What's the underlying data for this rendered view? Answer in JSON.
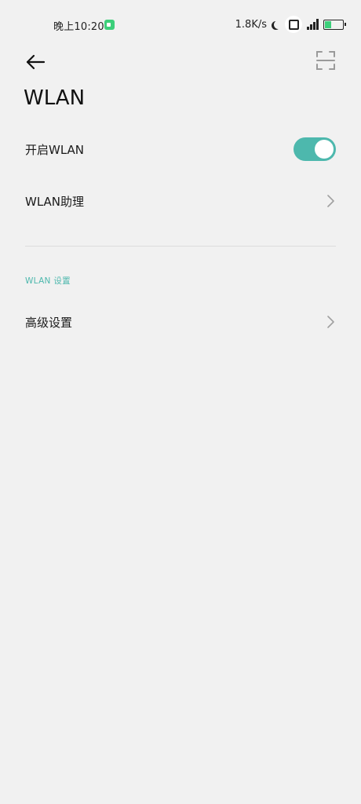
{
  "status_bar": {
    "time": "晚上10:20",
    "net_speed": "1.8K/s"
  },
  "header": {
    "title": "WLAN"
  },
  "settings": {
    "wlan_toggle_label": "开启WLAN",
    "wlan_toggle_on": true,
    "wlan_assistant_label": "WLAN助理",
    "section_label": "WLAN 设置",
    "advanced_label": "高级设置"
  },
  "colors": {
    "accent": "#4db8ad",
    "background": "#f1f1f1"
  },
  "icons": {
    "back": "arrow-left-icon",
    "scan": "qr-scan-icon",
    "chevron": "chevron-right-icon"
  }
}
